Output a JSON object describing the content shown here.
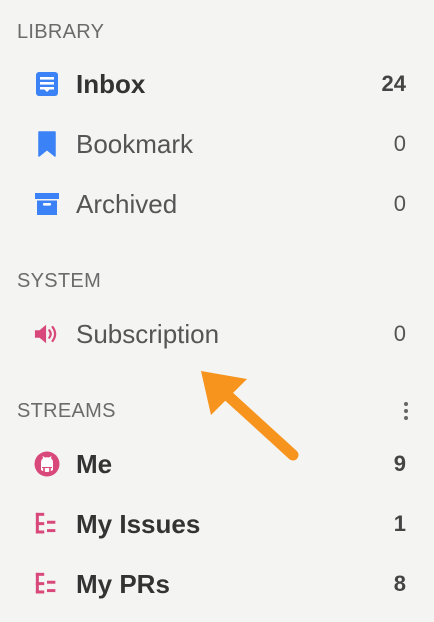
{
  "library": {
    "title": "LIBRARY",
    "items": [
      {
        "label": "Inbox",
        "count": "24",
        "icon": "inbox-icon"
      },
      {
        "label": "Bookmark",
        "count": "0",
        "icon": "bookmark-icon"
      },
      {
        "label": "Archived",
        "count": "0",
        "icon": "archive-icon"
      }
    ]
  },
  "system": {
    "title": "SYSTEM",
    "items": [
      {
        "label": "Subscription",
        "count": "0",
        "icon": "speaker-icon"
      }
    ]
  },
  "streams": {
    "title": "STREAMS",
    "menu_icon": "more-vertical-icon",
    "items": [
      {
        "label": "Me",
        "count": "9",
        "icon": "github-icon"
      },
      {
        "label": "My Issues",
        "count": "1",
        "icon": "tree-list-icon"
      },
      {
        "label": "My PRs",
        "count": "8",
        "icon": "tree-list-icon"
      }
    ]
  },
  "colors": {
    "blue": "#3b82f6",
    "pink": "#d9487a",
    "orange": "#f7941d",
    "background": "#f4f4f3"
  },
  "annotation": {
    "icon": "orange-arrow-icon"
  }
}
